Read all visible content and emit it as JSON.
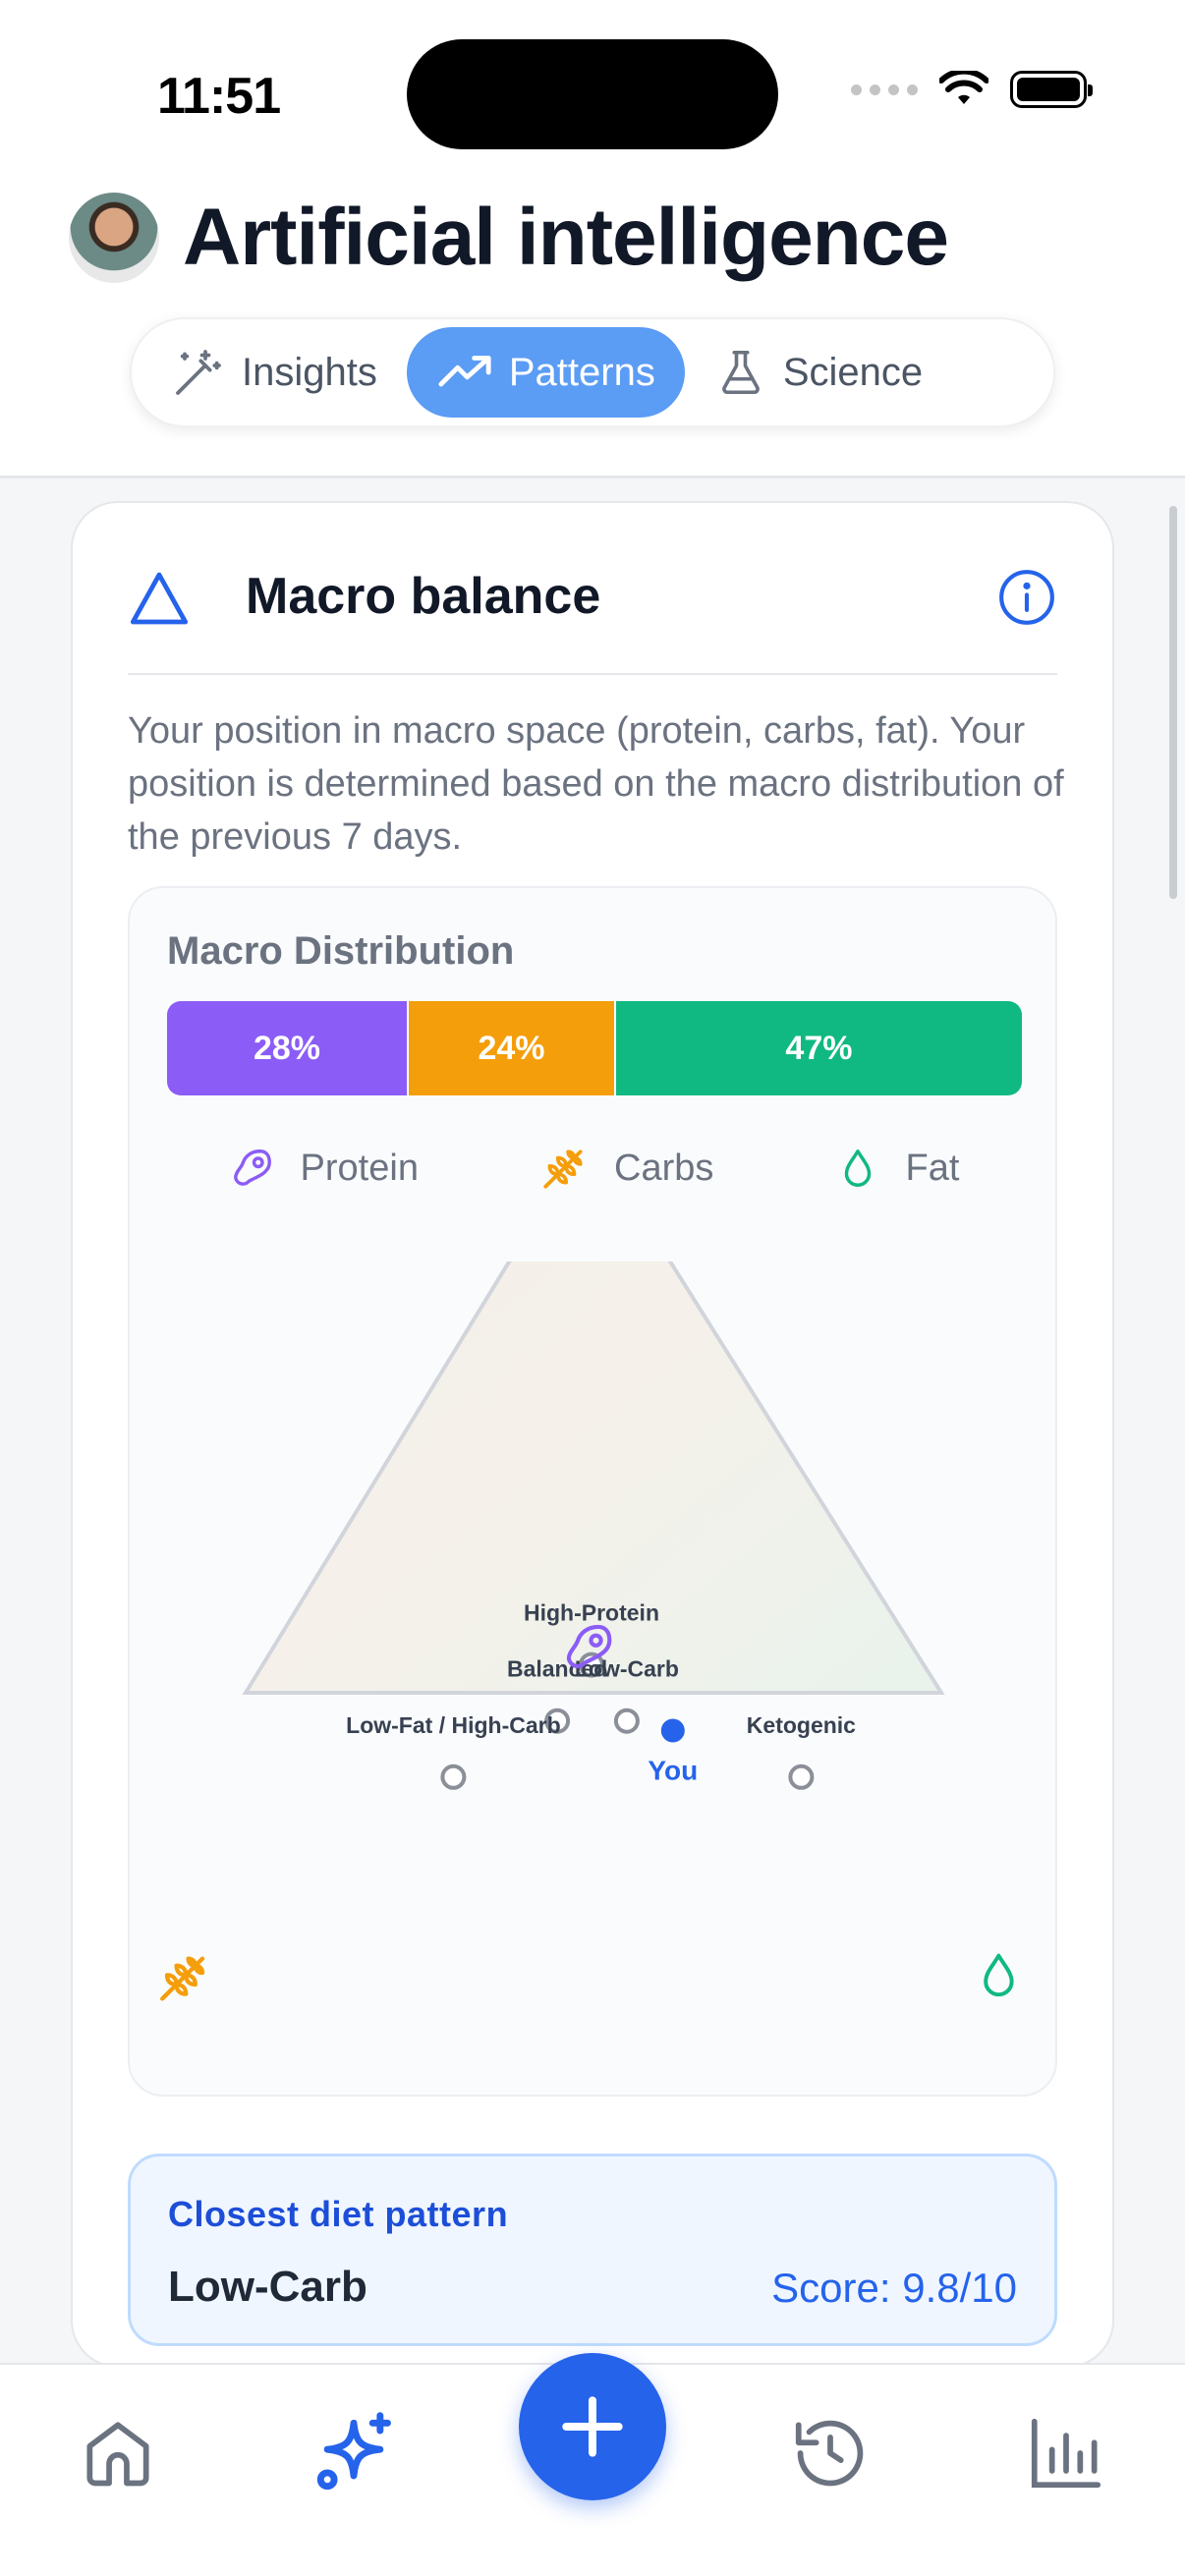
{
  "status_bar": {
    "time": "11:51"
  },
  "header": {
    "title": "Artificial intelligence"
  },
  "tabs": [
    {
      "label": "Insights",
      "icon": "magic-wand-icon",
      "active": false
    },
    {
      "label": "Patterns",
      "icon": "trending-up-icon",
      "active": true
    },
    {
      "label": "Science",
      "icon": "flask-icon",
      "active": false
    }
  ],
  "card": {
    "title": "Macro balance",
    "description": "Your position in macro space (protein, carbs, fat). Your position is determined based on the macro distribution of the previous 7 days."
  },
  "distribution": {
    "title": "Macro Distribution",
    "segments": [
      {
        "label": "28%",
        "value": 28,
        "color": "#8b5cf6"
      },
      {
        "label": "24%",
        "value": 24,
        "color": "#f59e0b"
      },
      {
        "label": "47%",
        "value": 47,
        "color": "#10b981"
      }
    ],
    "legend": [
      {
        "label": "Protein",
        "icon": "steak-icon",
        "color": "#8b5cf6"
      },
      {
        "label": "Carbs",
        "icon": "wheat-icon",
        "color": "#f59e0b"
      },
      {
        "label": "Fat",
        "icon": "droplet-icon",
        "color": "#10b981"
      }
    ]
  },
  "chart_data": {
    "type": "scatter",
    "description_axes": [
      "Protein",
      "Carbs",
      "Fat"
    ],
    "points": [
      {
        "label": "High-Protein",
        "protein": 40,
        "carbs": 30,
        "fat": 30
      },
      {
        "label": "Balanced",
        "protein": 30,
        "carbs": 40,
        "fat": 30
      },
      {
        "label": "Low-Carb",
        "protein": 30,
        "carbs": 30,
        "fat": 40
      },
      {
        "label": "Ketogenic",
        "protein": 20,
        "carbs": 10,
        "fat": 70
      },
      {
        "label": "Low-Fat / High-Carb",
        "protein": 20,
        "carbs": 60,
        "fat": 20
      },
      {
        "label": "You",
        "protein": 28,
        "carbs": 24,
        "fat": 47,
        "highlight": true
      }
    ]
  },
  "closest": {
    "label": "Closest diet pattern",
    "name": "Low-Carb",
    "score": "Score: 9.8/10"
  },
  "bottom_nav": [
    {
      "name": "home",
      "icon": "home-icon"
    },
    {
      "name": "ai",
      "icon": "sparkles-icon",
      "active": true
    },
    {
      "name": "add",
      "icon": "plus-icon"
    },
    {
      "name": "history",
      "icon": "history-icon"
    },
    {
      "name": "stats",
      "icon": "bar-chart-icon"
    }
  ]
}
